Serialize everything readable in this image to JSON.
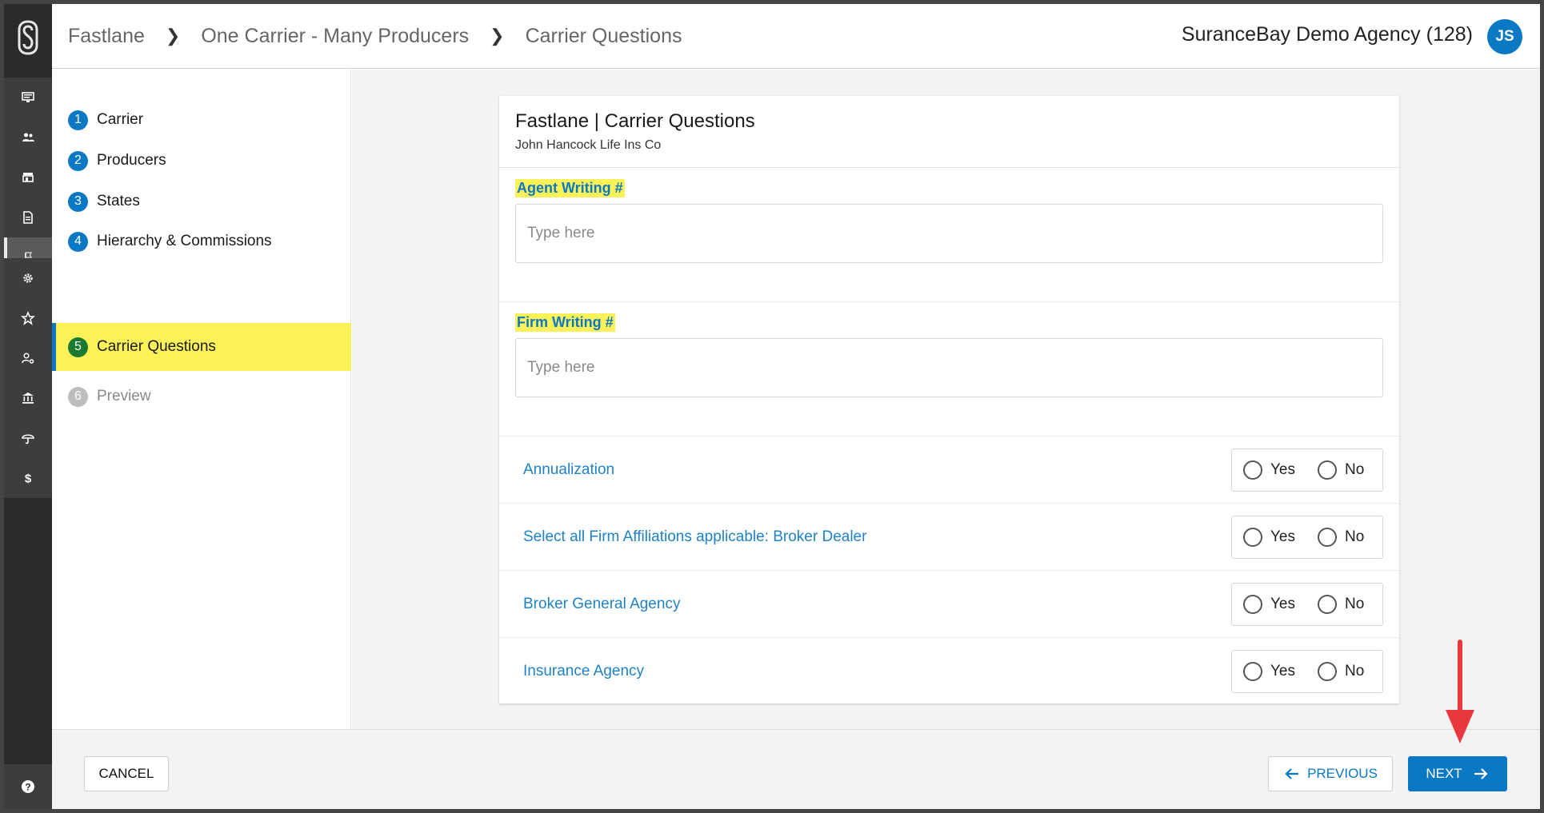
{
  "header": {
    "breadcrumb": [
      "Fastlane",
      "One Carrier - Many Producers",
      "Carrier Questions"
    ],
    "agency": "SuranceBay Demo Agency (128)",
    "avatar_initials": "JS"
  },
  "rail": {
    "icons_top": [
      "monitor-icon",
      "people-icon",
      "store-icon",
      "document-icon",
      "flag-icon"
    ],
    "icons_bottom": [
      "gear-icon",
      "star-icon",
      "user-settings-icon",
      "bank-icon",
      "umbrella-icon",
      "dollar-icon"
    ],
    "active": "flag-icon",
    "help": "help-icon"
  },
  "steps": [
    {
      "num": "1",
      "label": "Carrier",
      "state": "done"
    },
    {
      "num": "2",
      "label": "Producers",
      "state": "done"
    },
    {
      "num": "3",
      "label": "States",
      "state": "done"
    },
    {
      "num": "4",
      "label": "Hierarchy & Commissions",
      "state": "done"
    },
    {
      "num": "5",
      "label": "Carrier Questions",
      "state": "active"
    },
    {
      "num": "6",
      "label": "Preview",
      "state": "disabled"
    }
  ],
  "card": {
    "title": "Fastlane | Carrier Questions",
    "subtitle": "John Hancock Life Ins Co"
  },
  "fields": [
    {
      "label": "Agent Writing #",
      "placeholder": "Type here",
      "value": ""
    },
    {
      "label": "Firm Writing #",
      "placeholder": "Type here",
      "value": ""
    }
  ],
  "questions": [
    {
      "label": "Annualization",
      "yes": "Yes",
      "no": "No"
    },
    {
      "label": "Select all Firm Affiliations applicable: Broker Dealer",
      "yes": "Yes",
      "no": "No"
    },
    {
      "label": "Broker General Agency",
      "yes": "Yes",
      "no": "No"
    },
    {
      "label": "Insurance Agency",
      "yes": "Yes",
      "no": "No"
    }
  ],
  "footer": {
    "cancel": "CANCEL",
    "previous": "PREVIOUS",
    "next": "NEXT"
  },
  "colors": {
    "accent": "#0a78c2",
    "highlight": "#fbf25a",
    "annotation": "#e8383d"
  }
}
